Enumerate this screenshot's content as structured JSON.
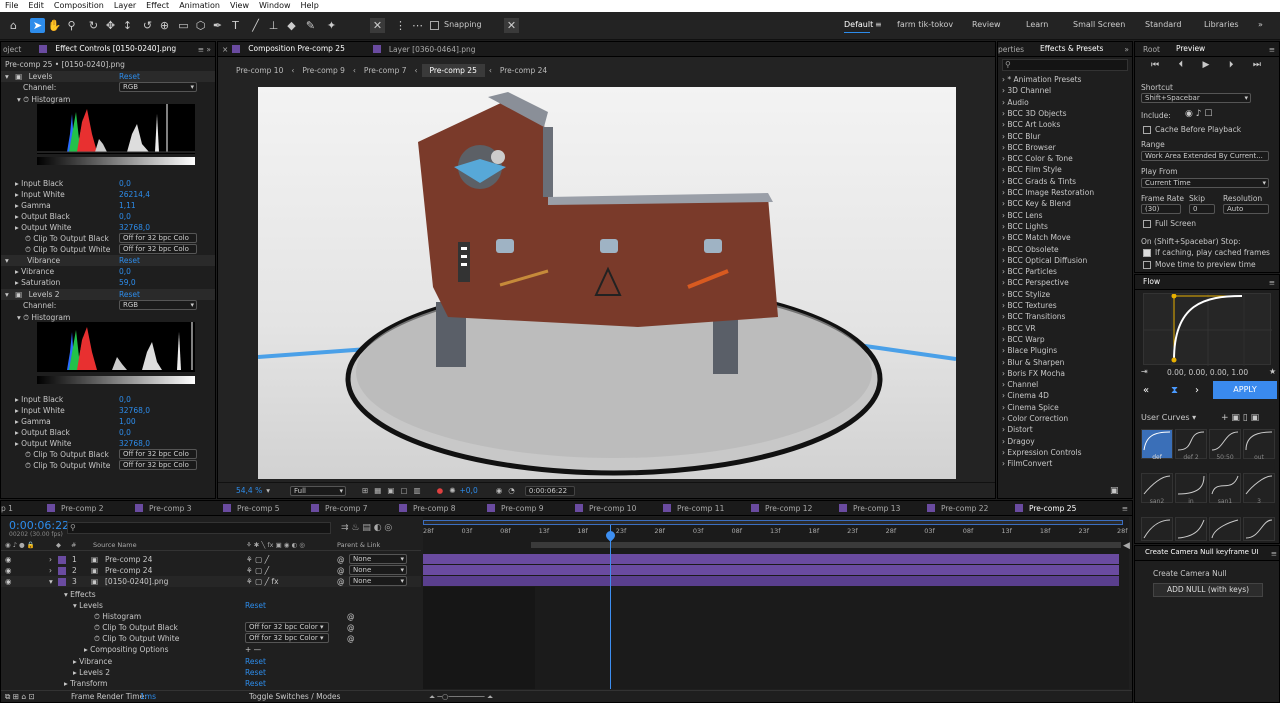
{
  "menu": [
    "File",
    "Edit",
    "Composition",
    "Layer",
    "Effect",
    "Animation",
    "View",
    "Window",
    "Help"
  ],
  "toolbar": {
    "snapping": "Snapping",
    "workspaces": [
      "Default",
      "farm tik-tokov",
      "Review",
      "Learn",
      "Small Screen",
      "Standard",
      "Libraries"
    ]
  },
  "left_panel": {
    "tab_partial": "oject",
    "tab": "Effect Controls [0150-0240].png",
    "subtitle": "Pre-comp 25 • [0150-0240].png",
    "levels1": {
      "name": "Levels",
      "reset": "Reset",
      "channel_label": "Channel:",
      "channel": "RGB",
      "histogram": "Histogram",
      "props": [
        [
          "Input Black",
          "0,0"
        ],
        [
          "Input White",
          "26214,4"
        ],
        [
          "Gamma",
          "1,11"
        ],
        [
          "Output Black",
          "0,0"
        ],
        [
          "Output White",
          "32768,0"
        ]
      ],
      "clip_black": "Clip To Output Black",
      "clip_white": "Clip To Output White",
      "clip_val": "Off for 32 bpc Colo"
    },
    "vibrance": {
      "name": "Vibrance",
      "reset": "Reset",
      "props": [
        [
          "Vibrance",
          "0,0"
        ],
        [
          "Saturation",
          "59,0"
        ]
      ]
    },
    "levels2": {
      "name": "Levels 2",
      "reset": "Reset",
      "channel_label": "Channel:",
      "channel": "RGB",
      "histogram": "Histogram",
      "props": [
        [
          "Input Black",
          "0,0"
        ],
        [
          "Input White",
          "32768,0"
        ],
        [
          "Gamma",
          "1,00"
        ],
        [
          "Output Black",
          "0,0"
        ],
        [
          "Output White",
          "32768,0"
        ]
      ],
      "clip_black": "Clip To Output Black",
      "clip_white": "Clip To Output White",
      "clip_val": "Off for 32 bpc Colo"
    }
  },
  "comp_panel": {
    "tab": "Composition Pre-comp 25",
    "layer_tab": "Layer [0360-0464].png",
    "breadcrumbs": [
      "Pre-comp 10",
      "Pre-comp 9",
      "Pre-comp 7",
      "Pre-comp 25",
      "Pre-comp 24"
    ],
    "zoom": "54,4 %",
    "resolution": "Full",
    "exposure": "+0,0",
    "timecode": "0:00:06:22"
  },
  "effects_panel": {
    "tab_partial": "perties",
    "tab": "Effects & Presets",
    "search_placeholder": "",
    "items": [
      "* Animation Presets",
      "3D Channel",
      "Audio",
      "BCC 3D Objects",
      "BCC Art Looks",
      "BCC Blur",
      "BCC Browser",
      "BCC Color & Tone",
      "BCC Film Style",
      "BCC Grads & Tints",
      "BCC Image Restoration",
      "BCC Key & Blend",
      "BCC Lens",
      "BCC Lights",
      "BCC Match Move",
      "BCC Obsolete",
      "BCC Optical Diffusion",
      "BCC Particles",
      "BCC Perspective",
      "BCC Stylize",
      "BCC Textures",
      "BCC Transitions",
      "BCC VR",
      "BCC Warp",
      "Blace Plugins",
      "Blur & Sharpen",
      "Boris FX Mocha",
      "Channel",
      "Cinema 4D",
      "Cinema Spice",
      "Color Correction",
      "Distort",
      "Dragoy",
      "Expression Controls",
      "FilmConvert"
    ]
  },
  "preview_panel": {
    "tabs": [
      "Root",
      "Preview"
    ],
    "shortcut_label": "Shortcut",
    "shortcut": "Shift+Spacebar",
    "include": "Include:",
    "cache": "Cache Before Playback",
    "range_label": "Range",
    "range": "Work Area Extended By Current...",
    "playfrom_label": "Play From",
    "playfrom": "Current Time",
    "framerate_label": "Frame Rate",
    "skip_label": "Skip",
    "resolution_label": "Resolution",
    "framerate": "(30)",
    "skip": "0",
    "resolution": "Auto",
    "fullscreen": "Full Screen",
    "stop_label": "On (Shift+Spacebar) Stop:",
    "stop1": "If caching, play cached frames",
    "stop2": "Move time to preview time"
  },
  "flow_panel": {
    "tab": "Flow",
    "values": "0.00, 0.00, 0.00, 1.00",
    "apply": "APPLY",
    "user_curves": "User Curves",
    "curves": [
      "def",
      "def 2",
      "50:50",
      "out",
      "san2",
      "in",
      "san1",
      "3"
    ]
  },
  "camnull_panel": {
    "tab": "Create Camera Null keyframe UI",
    "label": "Create Camera Null",
    "button": "ADD NULL (with keys)"
  },
  "timeline": {
    "tabs": [
      "p 1",
      "Pre-comp 2",
      "Pre-comp 3",
      "Pre-comp 5",
      "Pre-comp 7",
      "Pre-comp 8",
      "Pre-comp 9",
      "Pre-comp 10",
      "Pre-comp 11",
      "Pre-comp 12",
      "Pre-comp 13",
      "Pre-comp 22",
      "Pre-comp 25"
    ],
    "timecode": "0:00:06:22",
    "frames": "00202 (30.00 fps)",
    "col_hash": "#",
    "col_source": "Source Name",
    "col_parent": "Parent & Link",
    "layers": [
      {
        "n": "1",
        "name": "Pre-comp 24",
        "parent": "None"
      },
      {
        "n": "2",
        "name": "Pre-comp 24",
        "parent": "None"
      },
      {
        "n": "3",
        "name": "[0150-0240].png",
        "parent": "None"
      }
    ],
    "effects": "Effects",
    "levels": "Levels",
    "reset": "Reset",
    "histogram": "Histogram",
    "clip_black": "Clip To Output Black",
    "clip_white": "Clip To Output White",
    "clip_val": "Off for 32 bpc Color",
    "compositing": "Compositing Options",
    "vibrance": "Vibrance",
    "levels2": "Levels 2",
    "transform": "Transform",
    "render_label": "Frame Render Time:",
    "render_time": "1ms",
    "toggle": "Toggle Switches / Modes",
    "ruler": [
      "28f",
      "03f",
      "08f",
      "13f",
      "18f",
      "23f",
      "28f",
      "03f",
      "08f",
      "13f",
      "18f",
      "23f",
      "28f",
      "03f",
      "08f",
      "13f",
      "18f",
      "23f",
      "28f"
    ]
  }
}
